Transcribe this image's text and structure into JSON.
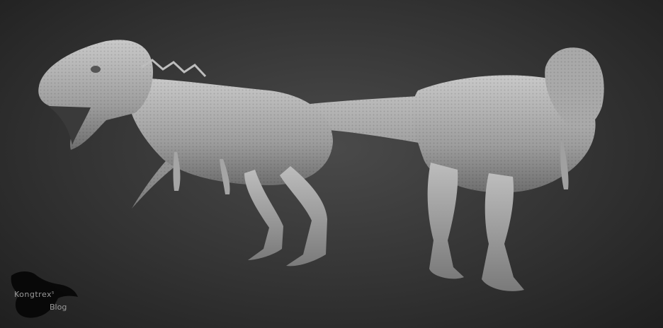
{
  "scene": {
    "subject_front": "t-rex-sculpt-side-view",
    "subject_back": "t-rex-sculpt-rear-view",
    "background_color": "#333333"
  },
  "watermark": {
    "line1": "Kongtrex",
    "superscript": "s",
    "line2": "Blog",
    "text_color": "#9a9a9a"
  }
}
